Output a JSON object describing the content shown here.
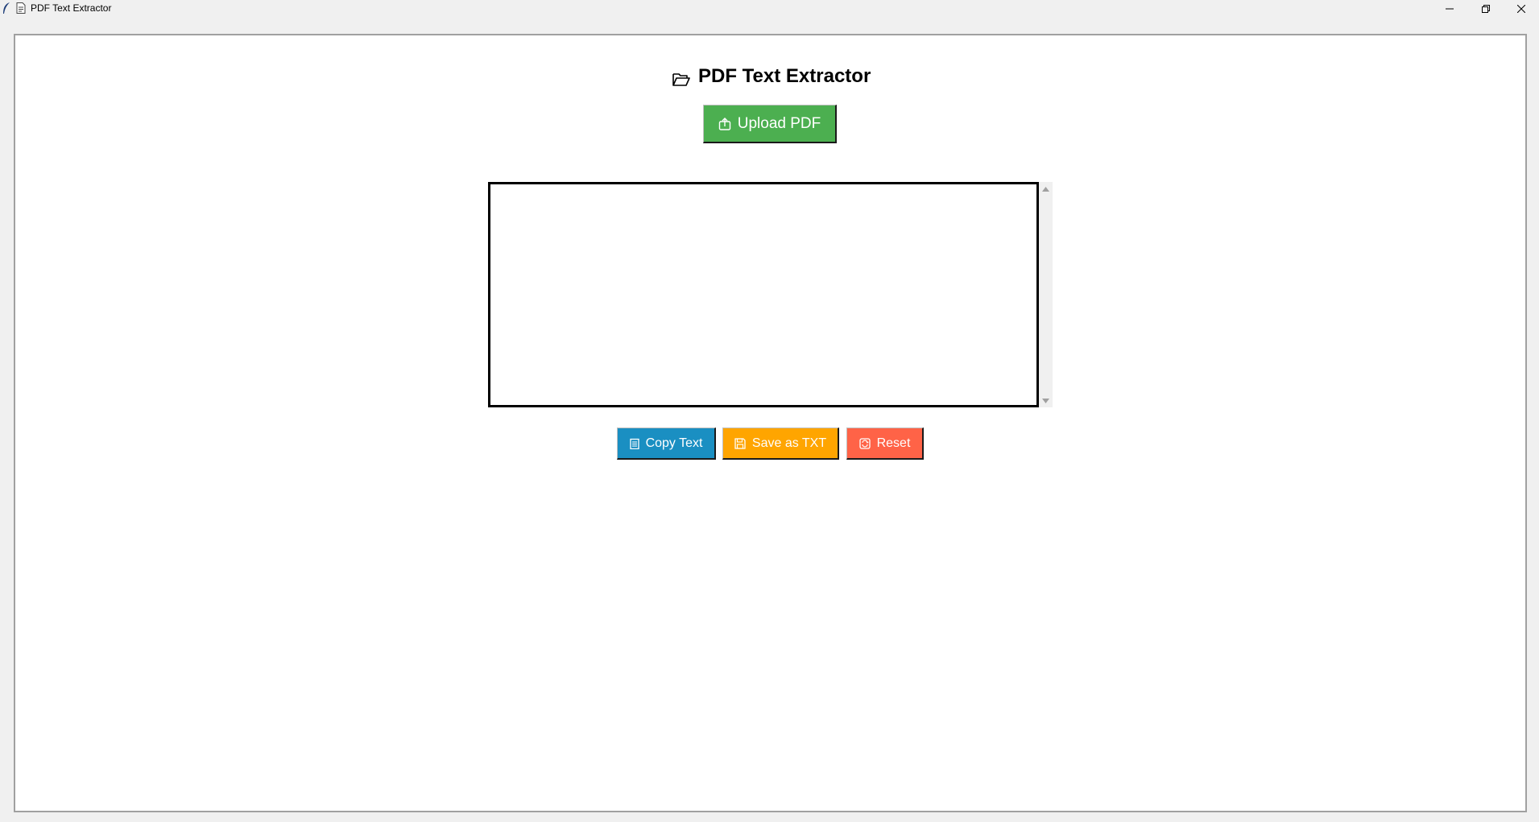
{
  "window": {
    "title": "PDF Text Extractor",
    "app_icon": "feather-icon",
    "doc_icon": "document-icon",
    "controls": [
      "minimize-icon",
      "restore-icon",
      "close-icon"
    ]
  },
  "header": {
    "icon": "open-folder-icon",
    "title": "PDF Text Extractor"
  },
  "upload_button": {
    "icon": "upload-icon",
    "label": "Upload PDF",
    "color": "#4caf50"
  },
  "text_area": {
    "value": ""
  },
  "actions": {
    "copy": {
      "icon": "clipboard-icon",
      "label": "Copy Text",
      "color": "#1a8fc2"
    },
    "save": {
      "icon": "floppy-disk-icon",
      "label": "Save as TXT",
      "color": "#ffa500"
    },
    "reset": {
      "icon": "reset-icon",
      "label": "Reset",
      "color": "#ff6347"
    }
  }
}
